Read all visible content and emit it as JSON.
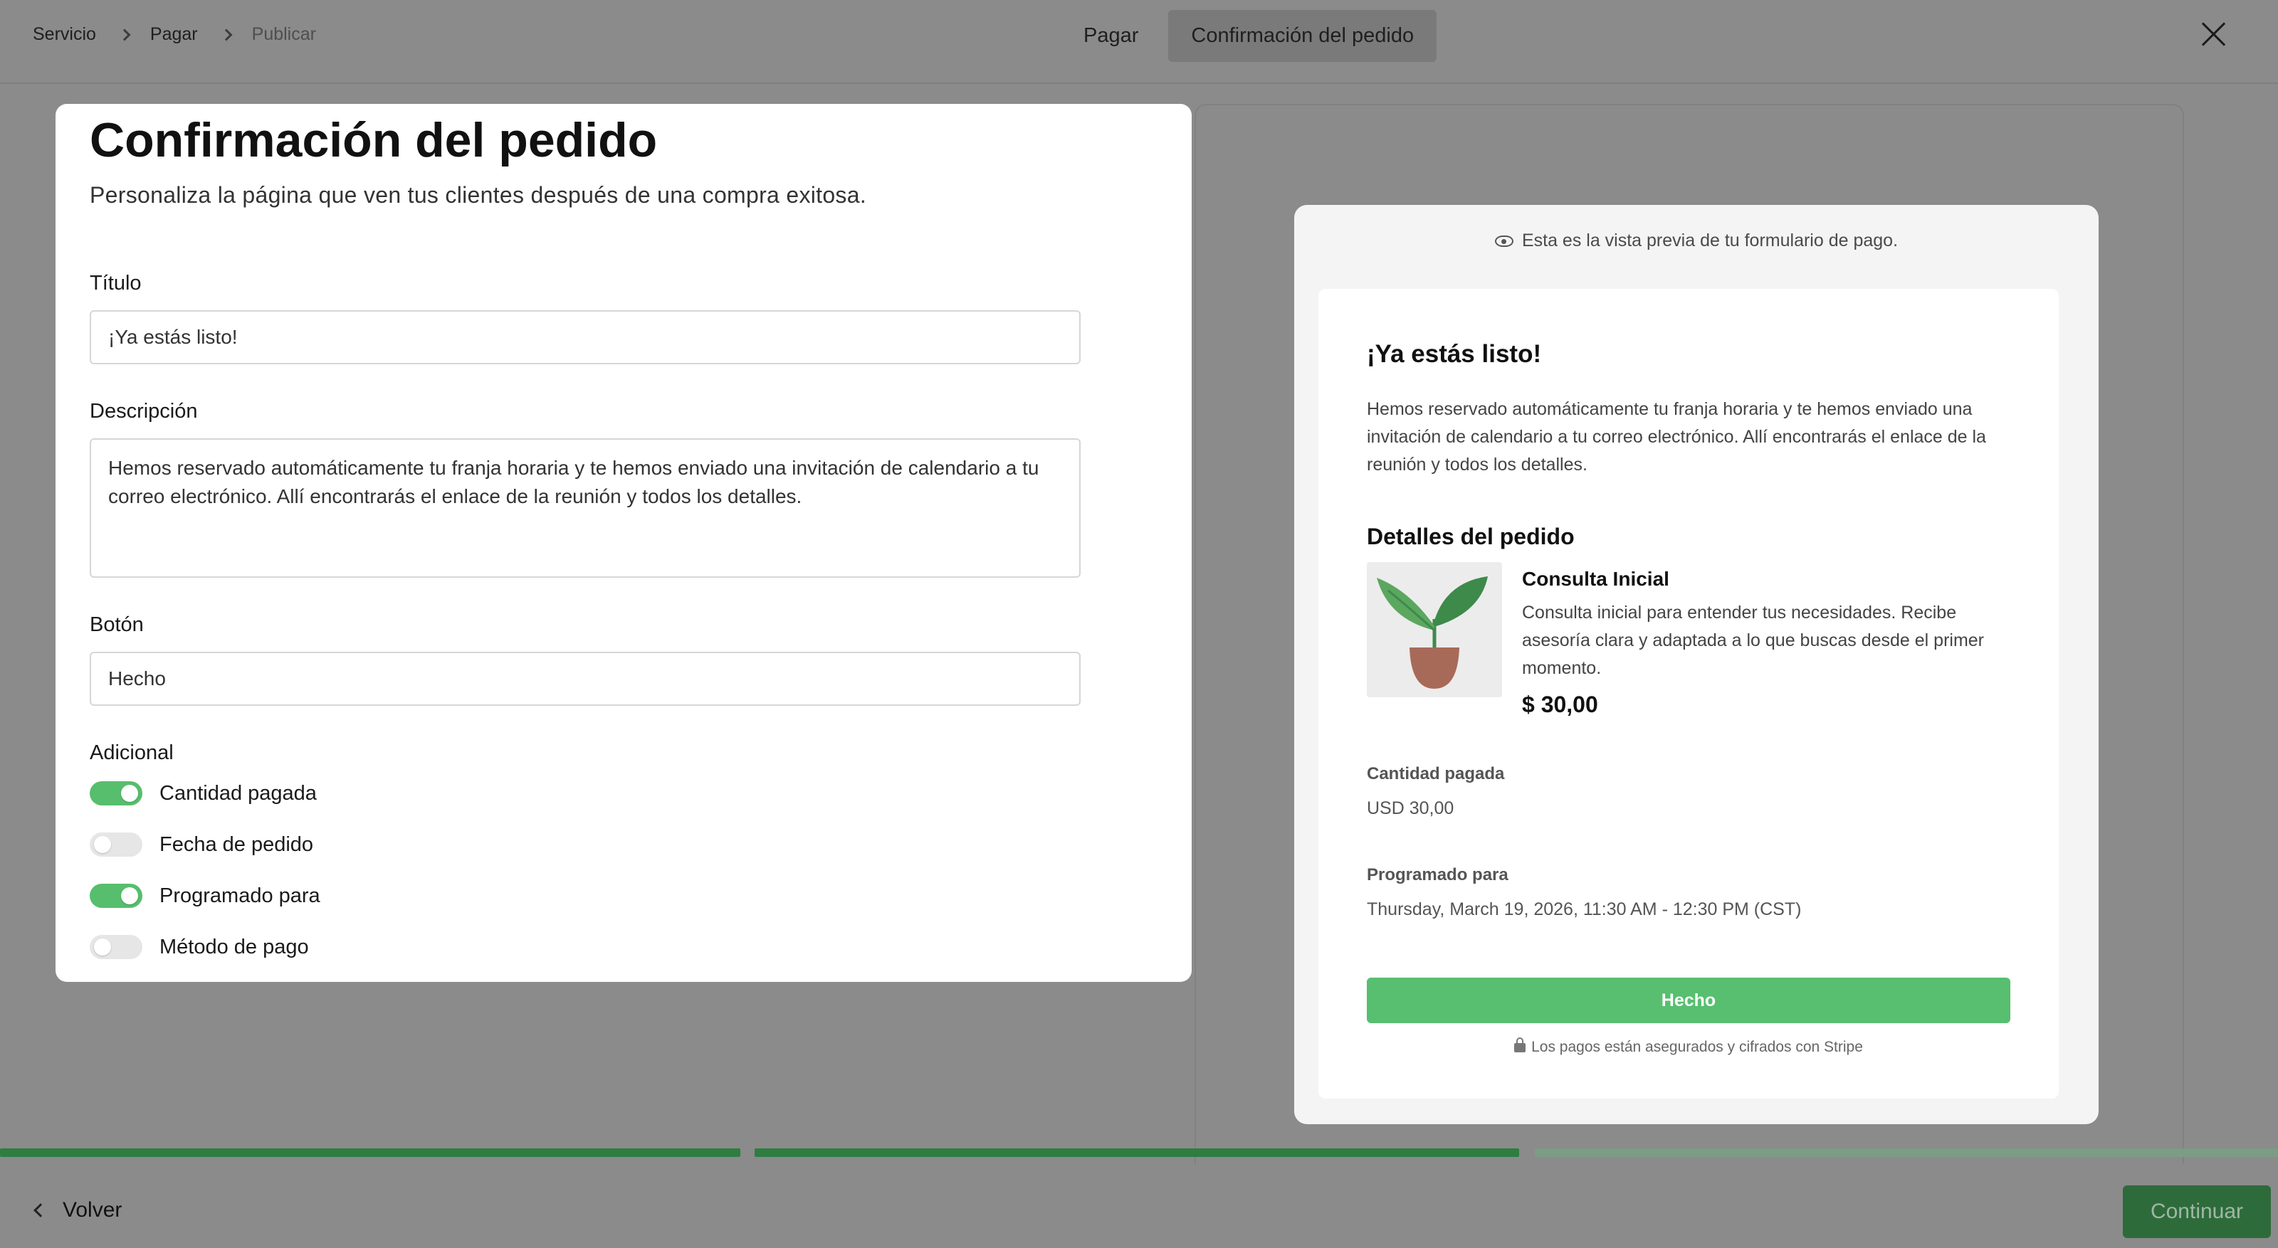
{
  "breadcrumb": {
    "items": [
      "Servicio",
      "Pagar",
      "Publicar"
    ]
  },
  "tabs": [
    {
      "label": "Pagar"
    },
    {
      "label": "Confirmación del pedido"
    }
  ],
  "form": {
    "title": "Confirmación del pedido",
    "subtitle": "Personaliza la página que ven tus clientes después de una compra exitosa.",
    "title_label": "Título",
    "title_value": "¡Ya estás listo!",
    "description_label": "Descripción",
    "description_value": "Hemos reservado automáticamente tu franja horaria y te hemos enviado una invitación de calendario a tu correo electrónico. Allí encontrarás el enlace de la reunión y todos los detalles.",
    "button_label": "Botón",
    "button_value": "Hecho",
    "additional_label": "Adicional",
    "toggles": [
      {
        "label": "Cantidad pagada",
        "on": true
      },
      {
        "label": "Fecha de pedido",
        "on": false
      },
      {
        "label": "Programado para",
        "on": true
      },
      {
        "label": "Método de pago",
        "on": false
      }
    ]
  },
  "preview": {
    "note": "Esta es la vista previa de tu formulario de pago.",
    "title": "¡Ya estás listo!",
    "description": "Hemos reservado automáticamente tu franja horaria y te hemos enviado una invitación de calendario a tu correo electrónico. Allí encontrarás el enlace de la reunión y todos los detalles.",
    "details_heading": "Detalles del pedido",
    "product_name": "Consulta Inicial",
    "product_desc": "Consulta inicial para entender tus necesidades. Recibe asesoría clara y adaptada a lo que buscas desde el primer momento.",
    "price": "$ 30,00",
    "amount_label": "Cantidad pagada",
    "amount_value": "USD 30,00",
    "scheduled_label": "Programado para",
    "scheduled_value": "Thursday, March 19, 2026, 11:30 AM - 12:30 PM (CST)",
    "button": "Hecho",
    "secure_note": "Los pagos están asegurados y cifrados con Stripe"
  },
  "progress": {
    "segments_complete": 2,
    "segments_total": 3
  },
  "footer": {
    "back_label": "Volver",
    "continue_label": "Continuar"
  },
  "colors": {
    "accent_green": "#56be6d",
    "dark_green": "#2e7d41",
    "overlay": "#8b8b8b"
  }
}
